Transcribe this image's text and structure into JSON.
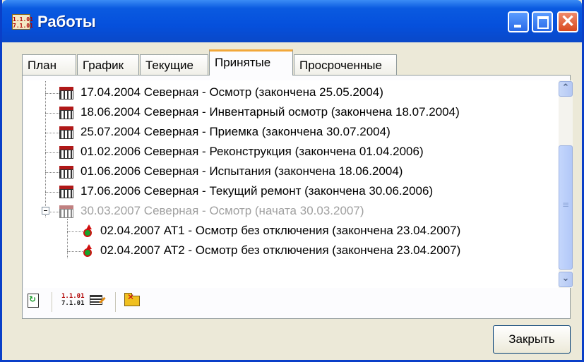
{
  "window": {
    "title": "Работы",
    "icon": "schedule-calendar-icon",
    "controls": [
      "minimize-icon",
      "maximize-icon",
      "close-icon"
    ],
    "close_glyph": "✕"
  },
  "tabs": [
    {
      "label": "План",
      "active": false
    },
    {
      "label": "График",
      "active": false
    },
    {
      "label": "Текущие",
      "active": false
    },
    {
      "label": "Принятые",
      "active": true
    },
    {
      "label": "Просроченные",
      "active": false
    }
  ],
  "tree": {
    "items": [
      {
        "text": "17.04.2004 Северная - Осмотр (закончена 25.05.2004)",
        "icon": "calendar-icon",
        "level": 1
      },
      {
        "text": "18.06.2004 Северная - Инвентарный осмотр (закончена 18.07.2004)",
        "icon": "calendar-icon",
        "level": 1
      },
      {
        "text": "25.07.2004 Северная - Приемка (закончена 30.07.2004)",
        "icon": "calendar-icon",
        "level": 1
      },
      {
        "text": "01.02.2006 Северная - Реконструкция (закончена 01.04.2006)",
        "icon": "calendar-icon",
        "level": 1
      },
      {
        "text": "01.06.2006 Северная - Испытания (закончена 18.06.2004)",
        "icon": "calendar-icon",
        "level": 1
      },
      {
        "text": "17.06.2006 Северная - Текущий ремонт (закончена 30.06.2006)",
        "icon": "calendar-icon",
        "level": 1
      },
      {
        "text": "30.03.2007 Северная - Осмотр (начата 30.03.2007)",
        "icon": "calendar-icon",
        "level": 1,
        "expanded": true,
        "muted": true
      },
      {
        "text": "02.04.2007 АТ1 - Осмотр без отключения (закончена 23.04.2007)",
        "icon": "action-icon",
        "level": 2
      },
      {
        "text": "02.04.2007 АТ2 - Осмотр без отключения (закончена 23.04.2007)",
        "icon": "action-icon",
        "level": 2
      }
    ]
  },
  "scrollbar": {
    "up_glyph": "⌃",
    "down_glyph": "⌄",
    "grip_glyph": "≡"
  },
  "toolbar": {
    "buttons": [
      "refresh-icon",
      "schedule-icon",
      "edit-icon",
      "delete-folder-icon"
    ],
    "schedule_icon_text": [
      "1.1.01",
      "7.1.01"
    ]
  },
  "footer": {
    "close_label": "Закрыть"
  },
  "colors": {
    "title_bar": "#0550dc",
    "active_tab_accent": "#f2a83a",
    "muted_text": "#a0a0a0",
    "window_bg": "#ece9d8"
  }
}
